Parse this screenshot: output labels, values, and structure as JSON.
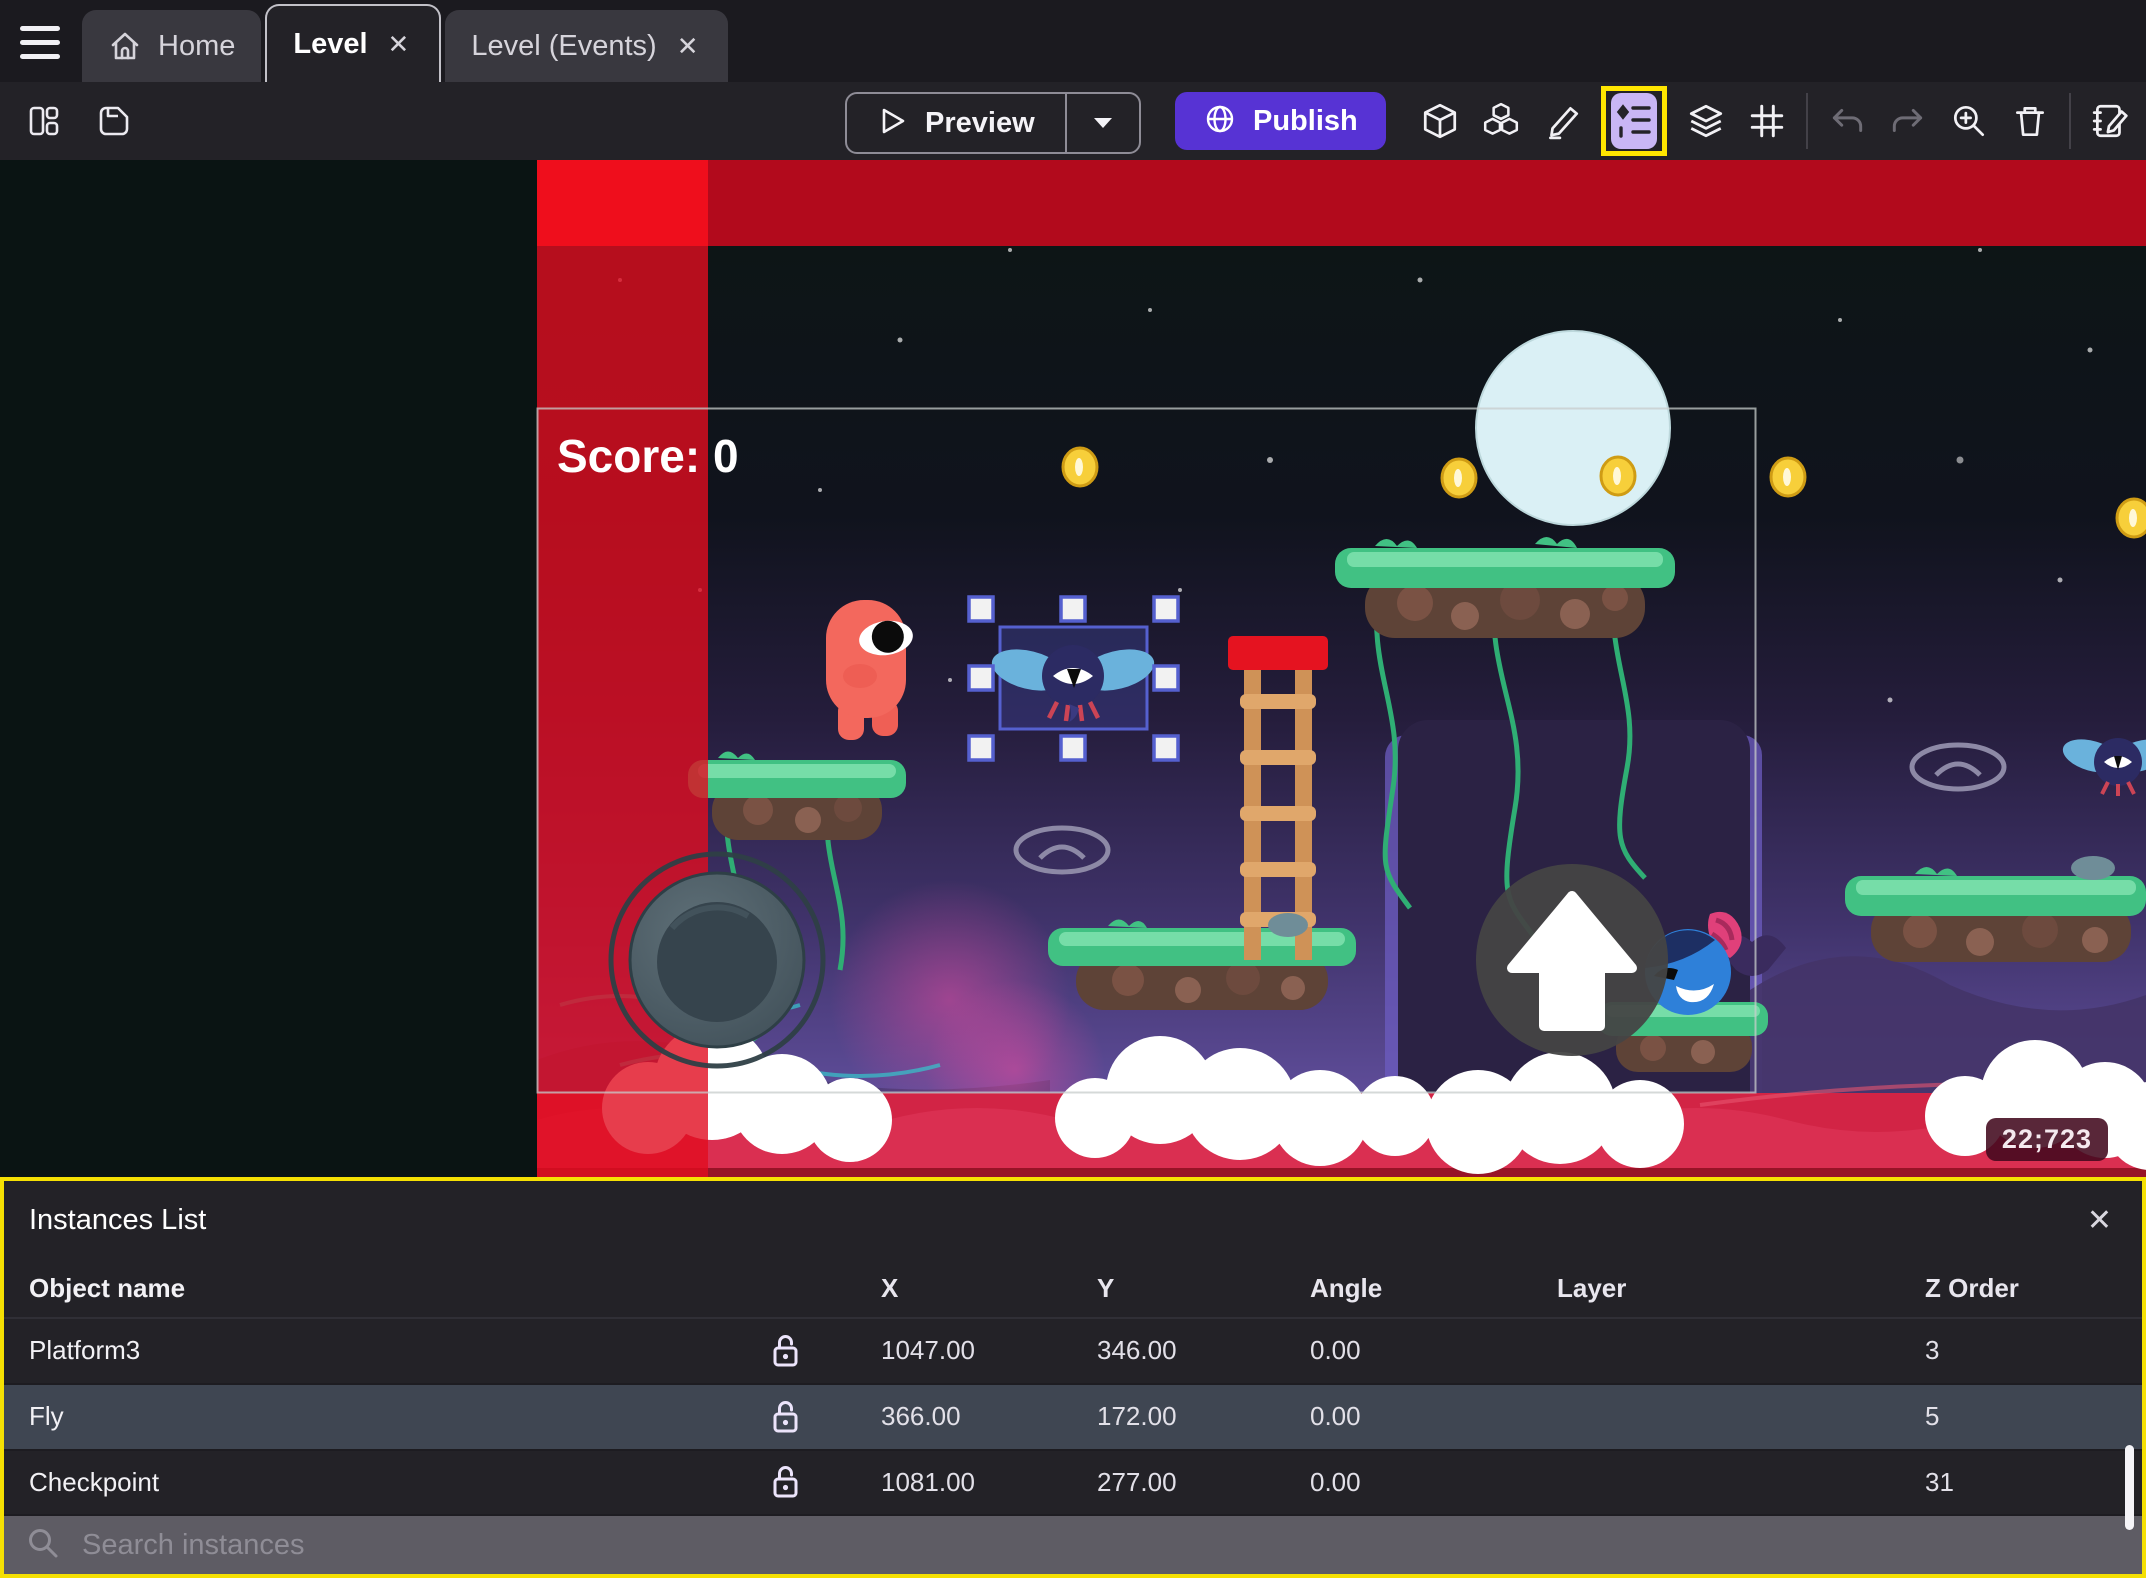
{
  "icons": {
    "close": "✕"
  },
  "tabbar": {
    "home": "Home",
    "level": "Level",
    "level_events": "Level (Events)"
  },
  "toolbar": {
    "preview": "Preview",
    "publish": "Publish"
  },
  "canvas": {
    "score": "Score: 0",
    "coords": "22;723"
  },
  "panel": {
    "title": "Instances List",
    "columns": [
      "Object name",
      "X",
      "Y",
      "Angle",
      "Layer",
      "Z Order"
    ],
    "rows": [
      {
        "name": "Platform3",
        "x": "1047.00",
        "y": "346.00",
        "angle": "0.00",
        "layer": "",
        "z": "3"
      },
      {
        "name": "Fly",
        "x": "366.00",
        "y": "172.00",
        "angle": "0.00",
        "layer": "",
        "z": "5"
      },
      {
        "name": "Checkpoint",
        "x": "1081.00",
        "y": "277.00",
        "angle": "0.00",
        "layer": "",
        "z": "31"
      }
    ],
    "search_placeholder": "Search instances"
  }
}
